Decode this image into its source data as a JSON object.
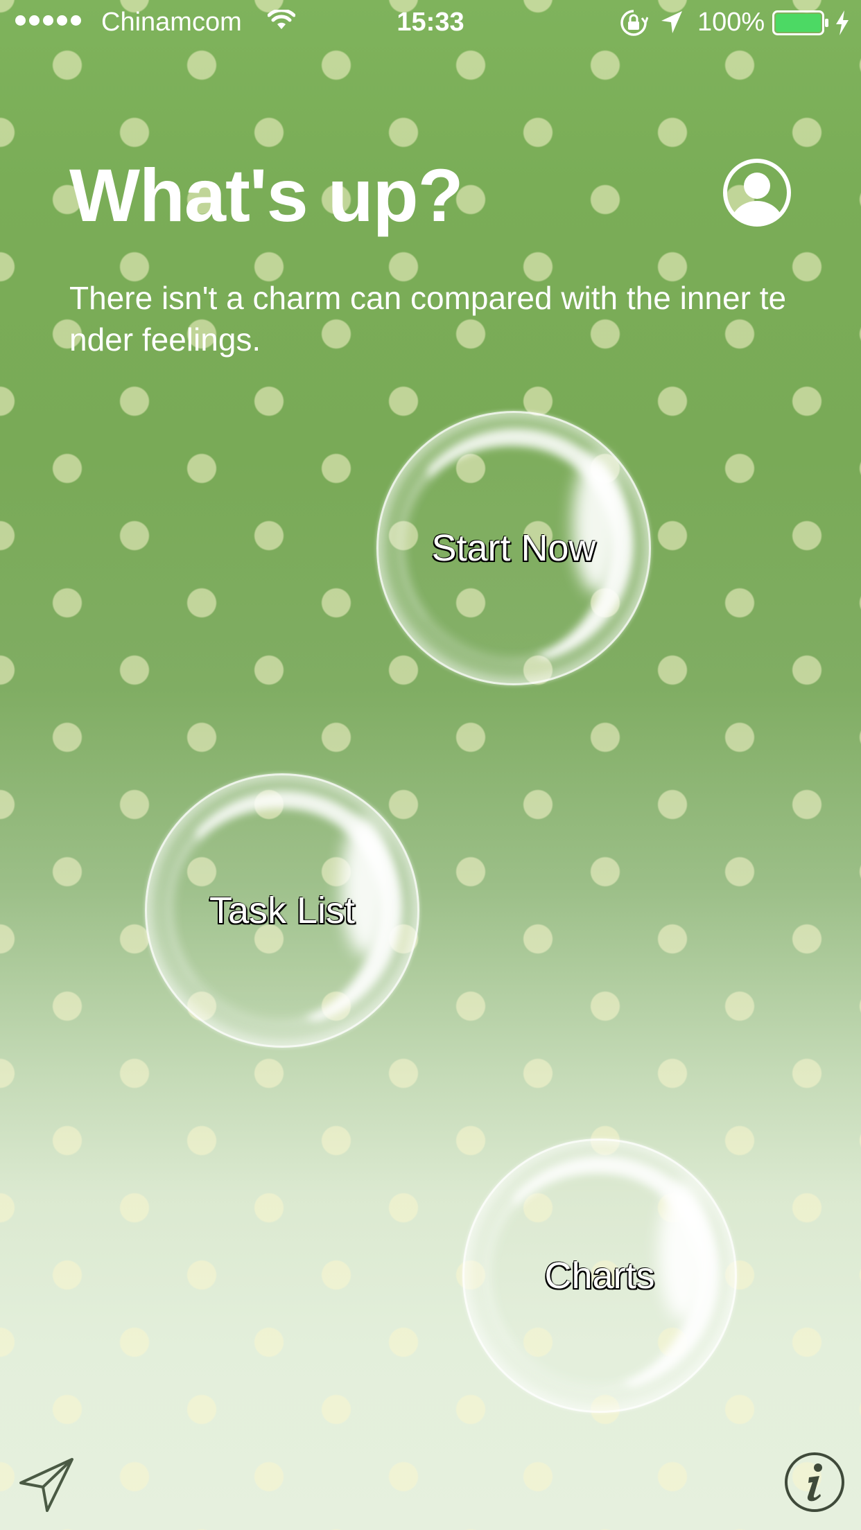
{
  "status_bar": {
    "carrier": "Chinamcom",
    "time": "15:33",
    "battery_percent": "100%",
    "icons": [
      "signal-dots-icon",
      "wifi-icon",
      "orientation-lock-icon",
      "location-arrow-icon",
      "battery-icon",
      "charging-bolt-icon"
    ]
  },
  "header": {
    "title": "What's up?",
    "subtitle": "There isn't a charm can compared with the inner tender feelings.",
    "profile_icon": "user-circle-icon"
  },
  "bubbles": {
    "start_label": "Start Now",
    "tasks_label": "Task List",
    "charts_label": "Charts"
  },
  "footer": {
    "left_icon": "send-arrow-icon",
    "right_icon": "info-icon"
  },
  "colors": {
    "background_top": "#7fb35c",
    "background_bottom": "#e6f0de",
    "dot": "#faf6cd",
    "text": "#ffffff",
    "battery_fill": "#4cd964"
  }
}
